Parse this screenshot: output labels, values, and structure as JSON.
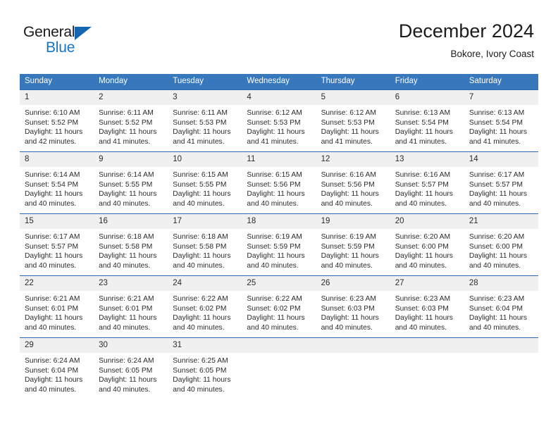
{
  "brand": {
    "name_top": "General",
    "name_bottom": "Blue",
    "accent_color": "#1874c4"
  },
  "header": {
    "title": "December 2024",
    "subtitle": "Bokore, Ivory Coast"
  },
  "theme": {
    "header_row_bg": "#3777bc",
    "row_divider": "#2a6bb0",
    "daynum_bg": "#f0f0f0"
  },
  "labels": {
    "sunrise_prefix": "Sunrise:",
    "sunset_prefix": "Sunset:",
    "daylight_prefix": "Daylight:"
  },
  "weekday_headers": [
    "Sunday",
    "Monday",
    "Tuesday",
    "Wednesday",
    "Thursday",
    "Friday",
    "Saturday"
  ],
  "weeks": [
    [
      {
        "day": "1",
        "sunrise": "Sunrise: 6:10 AM",
        "sunset": "Sunset: 5:52 PM",
        "daylight": "Daylight: 11 hours and 42 minutes."
      },
      {
        "day": "2",
        "sunrise": "Sunrise: 6:11 AM",
        "sunset": "Sunset: 5:52 PM",
        "daylight": "Daylight: 11 hours and 41 minutes."
      },
      {
        "day": "3",
        "sunrise": "Sunrise: 6:11 AM",
        "sunset": "Sunset: 5:53 PM",
        "daylight": "Daylight: 11 hours and 41 minutes."
      },
      {
        "day": "4",
        "sunrise": "Sunrise: 6:12 AM",
        "sunset": "Sunset: 5:53 PM",
        "daylight": "Daylight: 11 hours and 41 minutes."
      },
      {
        "day": "5",
        "sunrise": "Sunrise: 6:12 AM",
        "sunset": "Sunset: 5:53 PM",
        "daylight": "Daylight: 11 hours and 41 minutes."
      },
      {
        "day": "6",
        "sunrise": "Sunrise: 6:13 AM",
        "sunset": "Sunset: 5:54 PM",
        "daylight": "Daylight: 11 hours and 41 minutes."
      },
      {
        "day": "7",
        "sunrise": "Sunrise: 6:13 AM",
        "sunset": "Sunset: 5:54 PM",
        "daylight": "Daylight: 11 hours and 41 minutes."
      }
    ],
    [
      {
        "day": "8",
        "sunrise": "Sunrise: 6:14 AM",
        "sunset": "Sunset: 5:54 PM",
        "daylight": "Daylight: 11 hours and 40 minutes."
      },
      {
        "day": "9",
        "sunrise": "Sunrise: 6:14 AM",
        "sunset": "Sunset: 5:55 PM",
        "daylight": "Daylight: 11 hours and 40 minutes."
      },
      {
        "day": "10",
        "sunrise": "Sunrise: 6:15 AM",
        "sunset": "Sunset: 5:55 PM",
        "daylight": "Daylight: 11 hours and 40 minutes."
      },
      {
        "day": "11",
        "sunrise": "Sunrise: 6:15 AM",
        "sunset": "Sunset: 5:56 PM",
        "daylight": "Daylight: 11 hours and 40 minutes."
      },
      {
        "day": "12",
        "sunrise": "Sunrise: 6:16 AM",
        "sunset": "Sunset: 5:56 PM",
        "daylight": "Daylight: 11 hours and 40 minutes."
      },
      {
        "day": "13",
        "sunrise": "Sunrise: 6:16 AM",
        "sunset": "Sunset: 5:57 PM",
        "daylight": "Daylight: 11 hours and 40 minutes."
      },
      {
        "day": "14",
        "sunrise": "Sunrise: 6:17 AM",
        "sunset": "Sunset: 5:57 PM",
        "daylight": "Daylight: 11 hours and 40 minutes."
      }
    ],
    [
      {
        "day": "15",
        "sunrise": "Sunrise: 6:17 AM",
        "sunset": "Sunset: 5:57 PM",
        "daylight": "Daylight: 11 hours and 40 minutes."
      },
      {
        "day": "16",
        "sunrise": "Sunrise: 6:18 AM",
        "sunset": "Sunset: 5:58 PM",
        "daylight": "Daylight: 11 hours and 40 minutes."
      },
      {
        "day": "17",
        "sunrise": "Sunrise: 6:18 AM",
        "sunset": "Sunset: 5:58 PM",
        "daylight": "Daylight: 11 hours and 40 minutes."
      },
      {
        "day": "18",
        "sunrise": "Sunrise: 6:19 AM",
        "sunset": "Sunset: 5:59 PM",
        "daylight": "Daylight: 11 hours and 40 minutes."
      },
      {
        "day": "19",
        "sunrise": "Sunrise: 6:19 AM",
        "sunset": "Sunset: 5:59 PM",
        "daylight": "Daylight: 11 hours and 40 minutes."
      },
      {
        "day": "20",
        "sunrise": "Sunrise: 6:20 AM",
        "sunset": "Sunset: 6:00 PM",
        "daylight": "Daylight: 11 hours and 40 minutes."
      },
      {
        "day": "21",
        "sunrise": "Sunrise: 6:20 AM",
        "sunset": "Sunset: 6:00 PM",
        "daylight": "Daylight: 11 hours and 40 minutes."
      }
    ],
    [
      {
        "day": "22",
        "sunrise": "Sunrise: 6:21 AM",
        "sunset": "Sunset: 6:01 PM",
        "daylight": "Daylight: 11 hours and 40 minutes."
      },
      {
        "day": "23",
        "sunrise": "Sunrise: 6:21 AM",
        "sunset": "Sunset: 6:01 PM",
        "daylight": "Daylight: 11 hours and 40 minutes."
      },
      {
        "day": "24",
        "sunrise": "Sunrise: 6:22 AM",
        "sunset": "Sunset: 6:02 PM",
        "daylight": "Daylight: 11 hours and 40 minutes."
      },
      {
        "day": "25",
        "sunrise": "Sunrise: 6:22 AM",
        "sunset": "Sunset: 6:02 PM",
        "daylight": "Daylight: 11 hours and 40 minutes."
      },
      {
        "day": "26",
        "sunrise": "Sunrise: 6:23 AM",
        "sunset": "Sunset: 6:03 PM",
        "daylight": "Daylight: 11 hours and 40 minutes."
      },
      {
        "day": "27",
        "sunrise": "Sunrise: 6:23 AM",
        "sunset": "Sunset: 6:03 PM",
        "daylight": "Daylight: 11 hours and 40 minutes."
      },
      {
        "day": "28",
        "sunrise": "Sunrise: 6:23 AM",
        "sunset": "Sunset: 6:04 PM",
        "daylight": "Daylight: 11 hours and 40 minutes."
      }
    ],
    [
      {
        "day": "29",
        "sunrise": "Sunrise: 6:24 AM",
        "sunset": "Sunset: 6:04 PM",
        "daylight": "Daylight: 11 hours and 40 minutes."
      },
      {
        "day": "30",
        "sunrise": "Sunrise: 6:24 AM",
        "sunset": "Sunset: 6:05 PM",
        "daylight": "Daylight: 11 hours and 40 minutes."
      },
      {
        "day": "31",
        "sunrise": "Sunrise: 6:25 AM",
        "sunset": "Sunset: 6:05 PM",
        "daylight": "Daylight: 11 hours and 40 minutes."
      },
      {
        "day": "",
        "sunrise": "",
        "sunset": "",
        "daylight": ""
      },
      {
        "day": "",
        "sunrise": "",
        "sunset": "",
        "daylight": ""
      },
      {
        "day": "",
        "sunrise": "",
        "sunset": "",
        "daylight": ""
      },
      {
        "day": "",
        "sunrise": "",
        "sunset": "",
        "daylight": ""
      }
    ]
  ]
}
